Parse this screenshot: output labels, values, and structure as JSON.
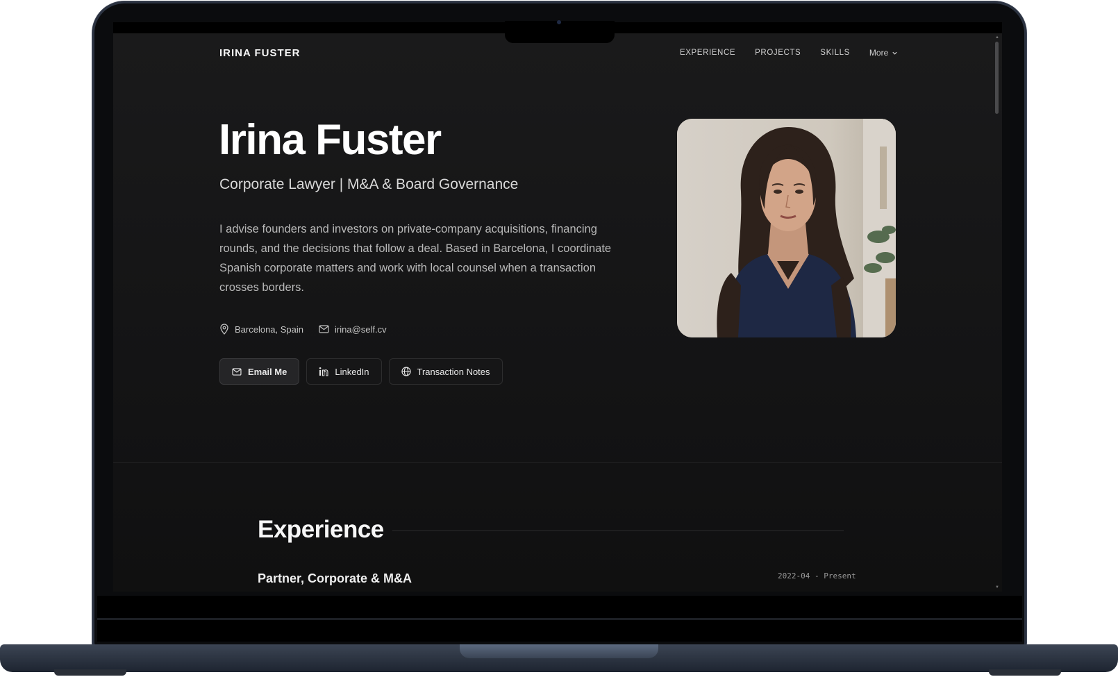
{
  "site": {
    "brand": "IRINA FUSTER",
    "nav": [
      {
        "label": "EXPERIENCE"
      },
      {
        "label": "PROJECTS"
      },
      {
        "label": "SKILLS"
      },
      {
        "label": "More"
      }
    ]
  },
  "hero": {
    "name": "Irina Fuster",
    "subtitle": "Corporate Lawyer | M&A & Board Governance",
    "bio": "I advise founders and investors on private-company acquisitions, financing rounds, and the decisions that follow a deal. Based in Barcelona, I coordinate Spanish corporate matters and work with local counsel when a transaction crosses borders.",
    "location": "Barcelona, Spain",
    "email": "irina@self.cv",
    "buttons": {
      "email": "Email Me",
      "linkedin": "LinkedIn",
      "notes": "Transaction Notes"
    }
  },
  "experience": {
    "heading": "Experience",
    "first_job_title": "Partner, Corporate & M&A",
    "first_job_dates": "2022-04 - Present"
  },
  "icons": {
    "location": "map-pin-icon",
    "email": "mail-icon",
    "linkedin": "linkedin-icon",
    "globe": "globe-icon",
    "more": "chevron-down-icon"
  },
  "colors": {
    "background": "#121213",
    "text": "#f3f3f3",
    "muted": "#b9b9b9",
    "button_border": "#2d2d2e"
  }
}
